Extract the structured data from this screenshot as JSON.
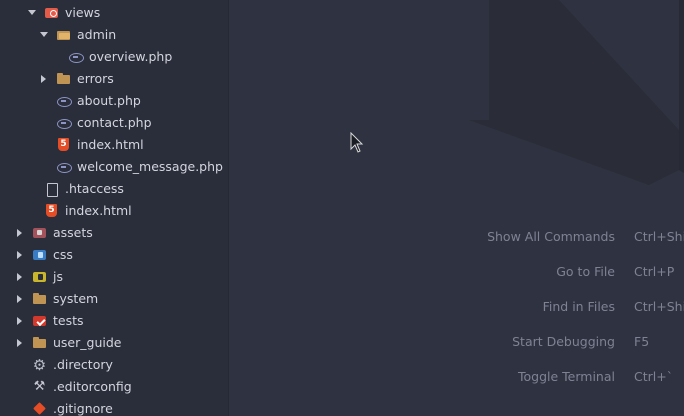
{
  "explorer": {
    "items": [
      {
        "label": "views",
        "icon": "views-folder-icon",
        "expanded": true
      },
      {
        "label": "admin",
        "icon": "folder-open-icon",
        "expanded": true
      },
      {
        "label": "overview.php",
        "icon": "php-file-icon"
      },
      {
        "label": "errors",
        "icon": "folder-icon",
        "expanded": false
      },
      {
        "label": "about.php",
        "icon": "php-file-icon"
      },
      {
        "label": "contact.php",
        "icon": "php-file-icon"
      },
      {
        "label": "index.html",
        "icon": "html5-file-icon"
      },
      {
        "label": "welcome_message.php",
        "icon": "php-file-icon"
      },
      {
        "label": ".htaccess",
        "icon": "file-icon"
      },
      {
        "label": "index.html",
        "icon": "html5-file-icon"
      },
      {
        "label": "assets",
        "icon": "assets-folder-icon",
        "expanded": false
      },
      {
        "label": "css",
        "icon": "css-folder-icon",
        "expanded": false
      },
      {
        "label": "js",
        "icon": "js-folder-icon",
        "expanded": false
      },
      {
        "label": "system",
        "icon": "folder-icon",
        "expanded": false
      },
      {
        "label": "tests",
        "icon": "tests-folder-icon",
        "expanded": false
      },
      {
        "label": "user_guide",
        "icon": "folder-icon",
        "expanded": false
      },
      {
        "label": ".directory",
        "icon": "gear-icon"
      },
      {
        "label": ".editorconfig",
        "icon": "editorconfig-icon"
      },
      {
        "label": ".gitignore",
        "icon": "git-icon"
      }
    ]
  },
  "shortcuts": [
    {
      "label": "Show All Commands",
      "key": "Ctrl+Shif"
    },
    {
      "label": "Go to File",
      "key": "Ctrl+P"
    },
    {
      "label": "Find in Files",
      "key": "Ctrl+Shif"
    },
    {
      "label": "Start Debugging",
      "key": "F5"
    },
    {
      "label": "Toggle Terminal",
      "key": "Ctrl+`"
    }
  ],
  "html5_badge": "5",
  "colors": {
    "sidebar_bg": "#2a2d3a",
    "editor_bg": "#2f3240",
    "text": "#d4d6de",
    "shortcut_text": "#7e8293",
    "folder": "#c09553"
  }
}
